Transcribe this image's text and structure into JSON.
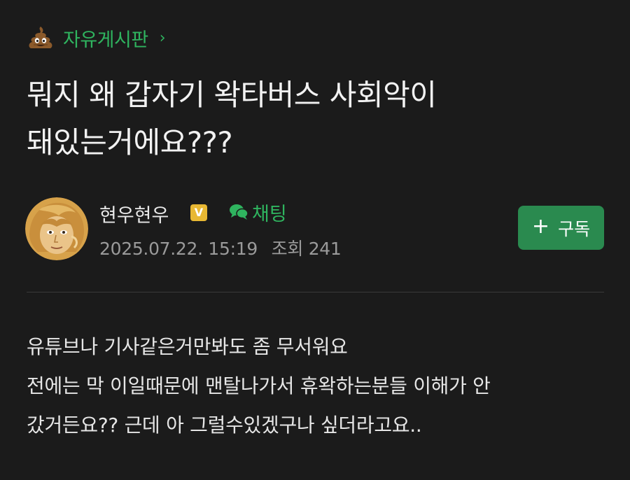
{
  "board": {
    "icon": "poop-emoji-icon",
    "label": "자유게시판",
    "chevron": "›"
  },
  "post": {
    "title_lines": [
      "뭐지 왜 갑자기 왁타버스 사회악이",
      "돼있는거에요???"
    ],
    "author": {
      "name": "현우현우",
      "verified_badge": "V",
      "chat_label": "채팅"
    },
    "date": "2025.07.22. 15:19",
    "views_label": "조회 241",
    "subscribe": {
      "plus": "+",
      "label": "구독"
    },
    "body_lines": [
      "유튜브나 기사같은거만봐도 좀 무서워요",
      "전에는 막 이일때문에 맨탈나가서 휴왁하는분들 이해가 안",
      "갔거든요?? 근데 아 그럴수있겠구나 싶더라고요.."
    ]
  },
  "colors": {
    "background": "#1b1b1b",
    "accent_green": "#2fb45f",
    "button_green": "#2a8a4f",
    "badge_yellow": "#e8b833"
  }
}
